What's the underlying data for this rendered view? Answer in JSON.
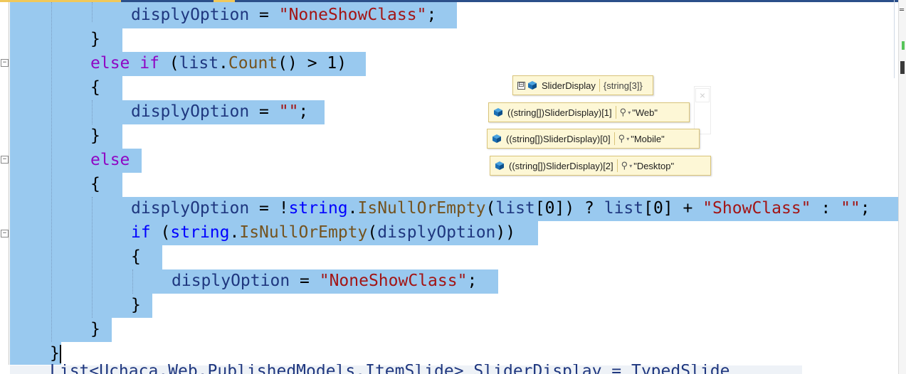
{
  "editor": {
    "lines": [
      {
        "tokens": [
          {
            "t": "displyOption",
            "c": "var"
          },
          {
            "t": " = ",
            "c": "pun"
          },
          {
            "t": "\"NoneShowClass\"",
            "c": "str"
          },
          {
            "t": ";",
            "c": "pun"
          }
        ]
      },
      {
        "tokens": [
          {
            "t": "}",
            "c": "pun"
          }
        ]
      },
      {
        "tokens": [
          {
            "t": "else",
            "c": "kw2"
          },
          {
            "t": " ",
            "c": "pun"
          },
          {
            "t": "if",
            "c": "kw2"
          },
          {
            "t": " (",
            "c": "pun"
          },
          {
            "t": "list",
            "c": "var"
          },
          {
            "t": ".",
            "c": "pun"
          },
          {
            "t": "Count",
            "c": "mth"
          },
          {
            "t": "() > 1)",
            "c": "pun"
          }
        ]
      },
      {
        "tokens": [
          {
            "t": "{",
            "c": "pun"
          }
        ]
      },
      {
        "tokens": [
          {
            "t": "displyOption",
            "c": "var"
          },
          {
            "t": " = ",
            "c": "pun"
          },
          {
            "t": "\"\"",
            "c": "str"
          },
          {
            "t": ";",
            "c": "pun"
          }
        ]
      },
      {
        "tokens": [
          {
            "t": "}",
            "c": "pun"
          }
        ]
      },
      {
        "tokens": [
          {
            "t": "else",
            "c": "kw2"
          }
        ]
      },
      {
        "tokens": [
          {
            "t": "{",
            "c": "pun"
          }
        ]
      },
      {
        "tokens": [
          {
            "t": "displyOption",
            "c": "var"
          },
          {
            "t": " = !",
            "c": "pun"
          },
          {
            "t": "string",
            "c": "kw"
          },
          {
            "t": ".",
            "c": "pun"
          },
          {
            "t": "IsNullOrEmpty",
            "c": "mth"
          },
          {
            "t": "(",
            "c": "pun"
          },
          {
            "t": "list",
            "c": "var"
          },
          {
            "t": "[0]) ? ",
            "c": "pun"
          },
          {
            "t": "list",
            "c": "var"
          },
          {
            "t": "[0] + ",
            "c": "pun"
          },
          {
            "t": "\"ShowClass\"",
            "c": "str"
          },
          {
            "t": " : ",
            "c": "pun"
          },
          {
            "t": "\"\"",
            "c": "str"
          },
          {
            "t": ";",
            "c": "pun"
          }
        ]
      },
      {
        "tokens": [
          {
            "t": "if",
            "c": "kw"
          },
          {
            "t": " (",
            "c": "pun"
          },
          {
            "t": "string",
            "c": "kw"
          },
          {
            "t": ".",
            "c": "pun"
          },
          {
            "t": "IsNullOrEmpty",
            "c": "mth"
          },
          {
            "t": "(",
            "c": "pun"
          },
          {
            "t": "displyOption",
            "c": "var"
          },
          {
            "t": "))",
            "c": "pun"
          }
        ]
      },
      {
        "tokens": [
          {
            "t": "{",
            "c": "pun"
          }
        ]
      },
      {
        "tokens": [
          {
            "t": "displyOption",
            "c": "var"
          },
          {
            "t": " = ",
            "c": "pun"
          },
          {
            "t": "\"NoneShowClass\"",
            "c": "str"
          },
          {
            "t": ";",
            "c": "pun"
          }
        ]
      },
      {
        "tokens": [
          {
            "t": "}",
            "c": "pun"
          }
        ]
      },
      {
        "tokens": [
          {
            "t": "}",
            "c": "pun"
          }
        ]
      },
      {
        "tokens": [
          {
            "t": "}",
            "c": "pun"
          }
        ]
      }
    ],
    "partial_line": "List<Uchaca.Web.PublishedModels.ItemSlide> SliderDisplay = TypedSlide"
  },
  "datatips": {
    "root": {
      "name": "SliderDisplay",
      "value": "{string[3]}",
      "expander": "⊟"
    },
    "items": [
      {
        "name": "((string[])SliderDisplay)[1]",
        "value": "\"Web\""
      },
      {
        "name": "((string[])SliderDisplay)[0]",
        "value": "\"Mobile\""
      },
      {
        "name": "((string[])SliderDisplay)[2]",
        "value": "\"Desktop\""
      }
    ],
    "close_glyph": "×",
    "search_glyph": "⚲",
    "dropdown_glyph": "▾"
  },
  "colors": {
    "selection": "#99c9ef",
    "keyword": "#0000ff",
    "control_keyword": "#8f08c4",
    "string": "#a31515",
    "method": "#74531f",
    "variable": "#1f377f",
    "datatip_bg": "#fdf7d6"
  },
  "icons": {
    "fold": "collapse-icon",
    "object": "object-cube-icon",
    "search": "magnifier-icon"
  }
}
